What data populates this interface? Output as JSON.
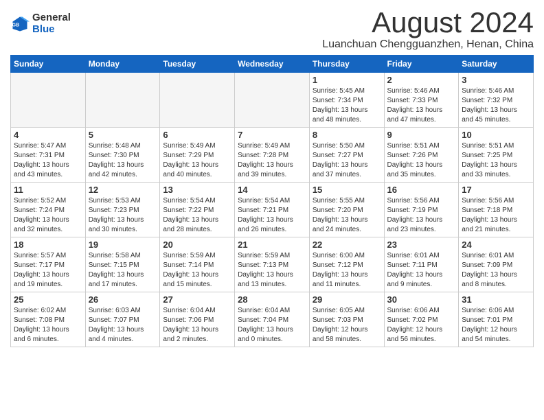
{
  "header": {
    "logo_general": "General",
    "logo_blue": "Blue",
    "month_title": "August 2024",
    "location": "Luanchuan Chengguanzhen, Henan, China"
  },
  "days_of_week": [
    "Sunday",
    "Monday",
    "Tuesday",
    "Wednesday",
    "Thursday",
    "Friday",
    "Saturday"
  ],
  "weeks": [
    [
      {
        "num": "",
        "info": ""
      },
      {
        "num": "",
        "info": ""
      },
      {
        "num": "",
        "info": ""
      },
      {
        "num": "",
        "info": ""
      },
      {
        "num": "1",
        "info": "Sunrise: 5:45 AM\nSunset: 7:34 PM\nDaylight: 13 hours\nand 48 minutes."
      },
      {
        "num": "2",
        "info": "Sunrise: 5:46 AM\nSunset: 7:33 PM\nDaylight: 13 hours\nand 47 minutes."
      },
      {
        "num": "3",
        "info": "Sunrise: 5:46 AM\nSunset: 7:32 PM\nDaylight: 13 hours\nand 45 minutes."
      }
    ],
    [
      {
        "num": "4",
        "info": "Sunrise: 5:47 AM\nSunset: 7:31 PM\nDaylight: 13 hours\nand 43 minutes."
      },
      {
        "num": "5",
        "info": "Sunrise: 5:48 AM\nSunset: 7:30 PM\nDaylight: 13 hours\nand 42 minutes."
      },
      {
        "num": "6",
        "info": "Sunrise: 5:49 AM\nSunset: 7:29 PM\nDaylight: 13 hours\nand 40 minutes."
      },
      {
        "num": "7",
        "info": "Sunrise: 5:49 AM\nSunset: 7:28 PM\nDaylight: 13 hours\nand 39 minutes."
      },
      {
        "num": "8",
        "info": "Sunrise: 5:50 AM\nSunset: 7:27 PM\nDaylight: 13 hours\nand 37 minutes."
      },
      {
        "num": "9",
        "info": "Sunrise: 5:51 AM\nSunset: 7:26 PM\nDaylight: 13 hours\nand 35 minutes."
      },
      {
        "num": "10",
        "info": "Sunrise: 5:51 AM\nSunset: 7:25 PM\nDaylight: 13 hours\nand 33 minutes."
      }
    ],
    [
      {
        "num": "11",
        "info": "Sunrise: 5:52 AM\nSunset: 7:24 PM\nDaylight: 13 hours\nand 32 minutes."
      },
      {
        "num": "12",
        "info": "Sunrise: 5:53 AM\nSunset: 7:23 PM\nDaylight: 13 hours\nand 30 minutes."
      },
      {
        "num": "13",
        "info": "Sunrise: 5:54 AM\nSunset: 7:22 PM\nDaylight: 13 hours\nand 28 minutes."
      },
      {
        "num": "14",
        "info": "Sunrise: 5:54 AM\nSunset: 7:21 PM\nDaylight: 13 hours\nand 26 minutes."
      },
      {
        "num": "15",
        "info": "Sunrise: 5:55 AM\nSunset: 7:20 PM\nDaylight: 13 hours\nand 24 minutes."
      },
      {
        "num": "16",
        "info": "Sunrise: 5:56 AM\nSunset: 7:19 PM\nDaylight: 13 hours\nand 23 minutes."
      },
      {
        "num": "17",
        "info": "Sunrise: 5:56 AM\nSunset: 7:18 PM\nDaylight: 13 hours\nand 21 minutes."
      }
    ],
    [
      {
        "num": "18",
        "info": "Sunrise: 5:57 AM\nSunset: 7:17 PM\nDaylight: 13 hours\nand 19 minutes."
      },
      {
        "num": "19",
        "info": "Sunrise: 5:58 AM\nSunset: 7:15 PM\nDaylight: 13 hours\nand 17 minutes."
      },
      {
        "num": "20",
        "info": "Sunrise: 5:59 AM\nSunset: 7:14 PM\nDaylight: 13 hours\nand 15 minutes."
      },
      {
        "num": "21",
        "info": "Sunrise: 5:59 AM\nSunset: 7:13 PM\nDaylight: 13 hours\nand 13 minutes."
      },
      {
        "num": "22",
        "info": "Sunrise: 6:00 AM\nSunset: 7:12 PM\nDaylight: 13 hours\nand 11 minutes."
      },
      {
        "num": "23",
        "info": "Sunrise: 6:01 AM\nSunset: 7:11 PM\nDaylight: 13 hours\nand 9 minutes."
      },
      {
        "num": "24",
        "info": "Sunrise: 6:01 AM\nSunset: 7:09 PM\nDaylight: 13 hours\nand 8 minutes."
      }
    ],
    [
      {
        "num": "25",
        "info": "Sunrise: 6:02 AM\nSunset: 7:08 PM\nDaylight: 13 hours\nand 6 minutes."
      },
      {
        "num": "26",
        "info": "Sunrise: 6:03 AM\nSunset: 7:07 PM\nDaylight: 13 hours\nand 4 minutes."
      },
      {
        "num": "27",
        "info": "Sunrise: 6:04 AM\nSunset: 7:06 PM\nDaylight: 13 hours\nand 2 minutes."
      },
      {
        "num": "28",
        "info": "Sunrise: 6:04 AM\nSunset: 7:04 PM\nDaylight: 13 hours\nand 0 minutes."
      },
      {
        "num": "29",
        "info": "Sunrise: 6:05 AM\nSunset: 7:03 PM\nDaylight: 12 hours\nand 58 minutes."
      },
      {
        "num": "30",
        "info": "Sunrise: 6:06 AM\nSunset: 7:02 PM\nDaylight: 12 hours\nand 56 minutes."
      },
      {
        "num": "31",
        "info": "Sunrise: 6:06 AM\nSunset: 7:01 PM\nDaylight: 12 hours\nand 54 minutes."
      }
    ]
  ]
}
